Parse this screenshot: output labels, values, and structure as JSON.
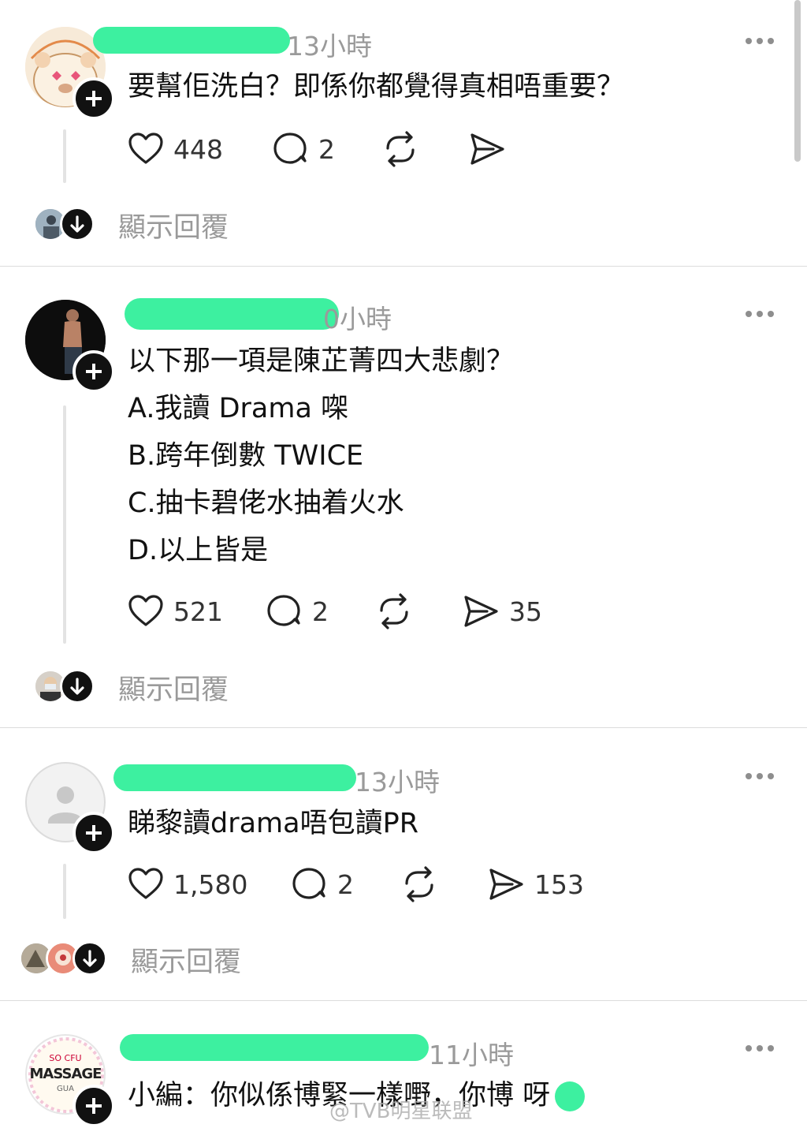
{
  "posts": [
    {
      "time": "13小時",
      "lines": [
        "要幫佢洗白？即係你都覺得真相唔重要？"
      ],
      "likes": "448",
      "comments": "2",
      "shares": "",
      "show_replies": "顯示回覆"
    },
    {
      "time": "0小時",
      "lines": [
        "以下那一項是陳芷菁四大悲劇？",
        "A.我讀 Drama 㗎",
        "B.跨年倒數 TWICE",
        "C.抽卡碧佬水抽着火水",
        "D.以上皆是"
      ],
      "likes": "521",
      "comments": "2",
      "shares": "35",
      "show_replies": "顯示回覆"
    },
    {
      "time": "13小時",
      "lines": [
        "睇黎讀drama唔包讀PR"
      ],
      "likes": "1,580",
      "comments": "2",
      "shares": "153",
      "show_replies": "顯示回覆"
    },
    {
      "time": "11小時",
      "lines": [
        "小編：你似係博緊一樣嘢，你博  呀"
      ],
      "avatar_text": [
        "SO CFU",
        "MASSAGE",
        "GUA"
      ]
    }
  ],
  "watermark": "@TVB明星联盟",
  "icons": {
    "like": "heart-icon",
    "comment": "comment-bubble-icon",
    "repost": "repost-icon",
    "share": "send-icon",
    "follow": "plus-icon",
    "more": "more-dots-icon",
    "expand": "arrow-down-icon"
  },
  "colors": {
    "redaction": "#3df0a0",
    "muted": "#9a9a9a"
  }
}
